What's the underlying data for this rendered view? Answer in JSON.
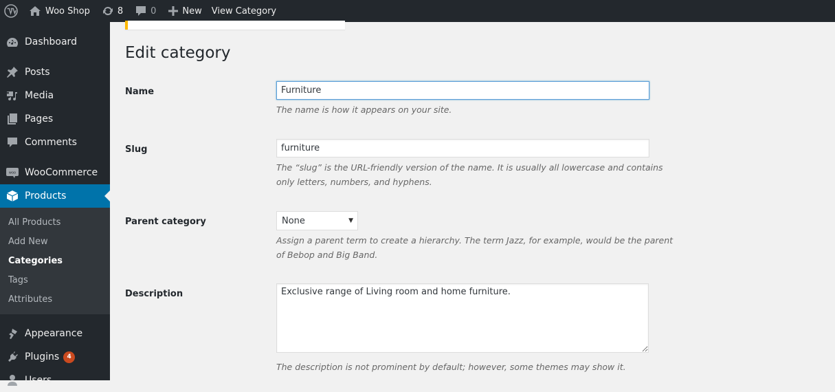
{
  "adminbar": {
    "site_name": "Woo Shop",
    "updates_count": "8",
    "comments_count": "0",
    "new_label": "New",
    "view_label": "View Category"
  },
  "sidebar": {
    "items": [
      {
        "label": "Dashboard",
        "icon": "dashboard-icon"
      },
      {
        "label": "Posts",
        "icon": "pin-icon"
      },
      {
        "label": "Media",
        "icon": "media-icon"
      },
      {
        "label": "Pages",
        "icon": "pages-icon"
      },
      {
        "label": "Comments",
        "icon": "comment-icon"
      },
      {
        "label": "WooCommerce",
        "icon": "woo-icon"
      },
      {
        "label": "Products",
        "icon": "box-icon",
        "current": true
      },
      {
        "label": "Appearance",
        "icon": "brush-icon"
      },
      {
        "label": "Plugins",
        "icon": "plug-icon",
        "badge": "4"
      },
      {
        "label": "Users",
        "icon": "user-icon"
      }
    ],
    "products_submenu": [
      {
        "label": "All Products"
      },
      {
        "label": "Add New"
      },
      {
        "label": "Categories",
        "current": true
      },
      {
        "label": "Tags"
      },
      {
        "label": "Attributes"
      }
    ]
  },
  "page": {
    "title": "Edit category",
    "fields": {
      "name": {
        "label": "Name",
        "value": "Furniture",
        "description": "The name is how it appears on your site."
      },
      "slug": {
        "label": "Slug",
        "value": "furniture",
        "description": "The “slug” is the URL-friendly version of the name. It is usually all lowercase and contains only letters, numbers, and hyphens."
      },
      "parent": {
        "label": "Parent category",
        "selected": "None",
        "description": "Assign a parent term to create a hierarchy. The term Jazz, for example, would be the parent of Bebop and Big Band."
      },
      "description": {
        "label": "Description",
        "value": "Exclusive range of Living room and home furniture.",
        "description": "The description is not prominent by default; however, some themes may show it."
      }
    }
  },
  "colors": {
    "admin_dark": "#23282d",
    "accent": "#0073aa",
    "notice_warning": "#ffb900",
    "badge": "#ca4a1f"
  }
}
